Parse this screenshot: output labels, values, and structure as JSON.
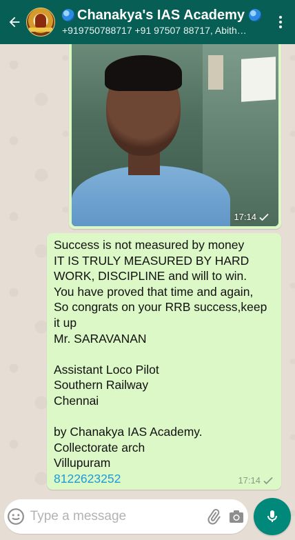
{
  "header": {
    "title": "Chanakya's IAS Academy",
    "subtitle": "+919750788717 +91 97507 88717, Abith…"
  },
  "messages": {
    "image": {
      "time": "17:14"
    },
    "text": {
      "body": "Success is not measured by money\nIT IS TRULY MEASURED BY HARD WORK, DISCIPLINE and will to win.\nYou have proved that time and again,\nSo congrats on your RRB success,keep it up\nMr. SARAVANAN\n\nAssistant Loco Pilot\nSouthern Railway\nChennai\n\nby Chanakya IAS Academy.\nCollectorate arch\nVillupuram\n",
      "phone": "8122623252",
      "time": "17:14"
    }
  },
  "composer": {
    "placeholder": "Type a message"
  },
  "colors": {
    "header": "#075e54",
    "bubble": "#dcf8c6",
    "mic": "#00897b",
    "link": "#1a9bd7"
  },
  "icons": [
    "back-arrow-icon",
    "globe-icon",
    "more-vert-icon",
    "check-icon",
    "emoji-icon",
    "paperclip-icon",
    "camera-icon",
    "mic-icon"
  ]
}
